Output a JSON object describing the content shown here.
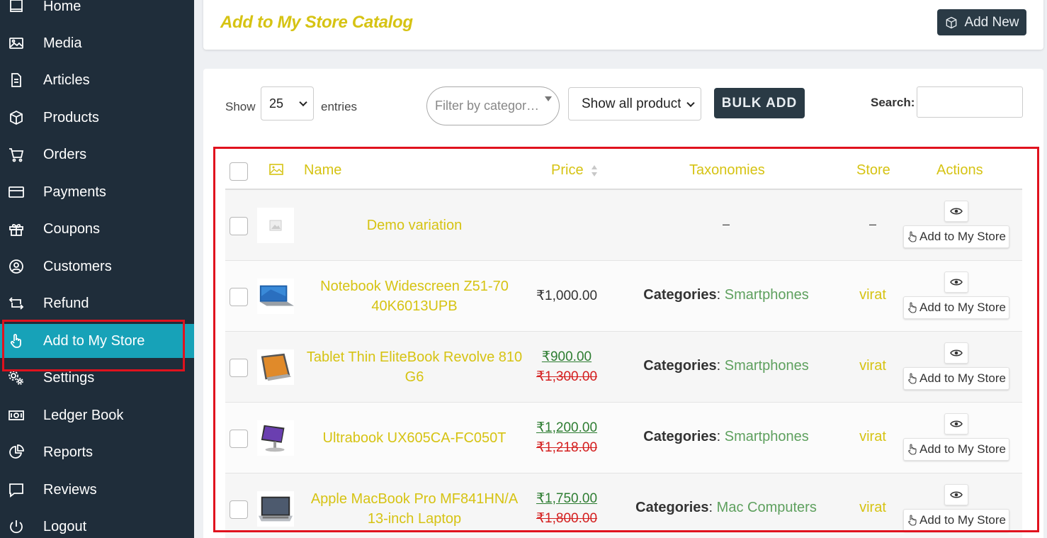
{
  "sidebar": {
    "items": [
      {
        "label": "Home",
        "icon": "home-icon"
      },
      {
        "label": "Media",
        "icon": "image-icon"
      },
      {
        "label": "Articles",
        "icon": "document-icon"
      },
      {
        "label": "Products",
        "icon": "box-icon"
      },
      {
        "label": "Orders",
        "icon": "cart-icon"
      },
      {
        "label": "Payments",
        "icon": "credit-card-icon"
      },
      {
        "label": "Coupons",
        "icon": "gift-icon"
      },
      {
        "label": "Customers",
        "icon": "user-circle-icon"
      },
      {
        "label": "Refund",
        "icon": "refund-icon"
      },
      {
        "label": "Add to My Store",
        "icon": "hand-pointer-icon",
        "active": true
      },
      {
        "label": "Settings",
        "icon": "cogs-icon"
      },
      {
        "label": "Ledger Book",
        "icon": "money-icon"
      },
      {
        "label": "Reports",
        "icon": "pie-chart-icon"
      },
      {
        "label": "Reviews",
        "icon": "comment-icon"
      },
      {
        "label": "Logout",
        "icon": "power-icon"
      }
    ]
  },
  "header": {
    "title": "Add to My Store Catalog",
    "add_new_label": "Add New"
  },
  "controls": {
    "show_label": "Show",
    "entries_value": "25",
    "entries_label": "entries",
    "category_placeholder": "Filter by categor…",
    "product_filter_value": "Show all products",
    "bulk_add_label": "BULK ADD",
    "search_label": "Search:",
    "search_value": ""
  },
  "table": {
    "columns": [
      "",
      "image-icon",
      "Name",
      "Price",
      "Taxonomies",
      "Store",
      "Actions"
    ],
    "add_to_store_label": "Add to My Store",
    "rows": [
      {
        "name": "Demo variation",
        "price": "",
        "sale_price": "",
        "old_price": "",
        "taxonomy_label": "",
        "taxonomy_value": "",
        "taxonomy_dash": "–",
        "store": "–",
        "thumb": "placeholder"
      },
      {
        "name": "Notebook Widescreen Z51-70 40K6013UPB",
        "price": "₹1,000.00",
        "sale_price": "",
        "old_price": "",
        "taxonomy_label": "Categories",
        "taxonomy_value": "Smartphones",
        "taxonomy_dash": "",
        "store": "virat",
        "thumb": "laptop"
      },
      {
        "name": "Tablet Thin EliteBook Revolve 810 G6",
        "price": "",
        "sale_price": "₹900.00",
        "old_price": "₹1,300.00",
        "taxonomy_label": "Categories",
        "taxonomy_value": "Smartphones",
        "taxonomy_dash": "",
        "store": "virat",
        "thumb": "tablet"
      },
      {
        "name": "Ultrabook UX605CA-FC050T",
        "price": "",
        "sale_price": "₹1,200.00",
        "old_price": "₹1,218.00",
        "taxonomy_label": "Categories",
        "taxonomy_value": "Smartphones",
        "taxonomy_dash": "",
        "store": "virat",
        "thumb": "stand"
      },
      {
        "name": "Apple MacBook Pro MF841HN/A 13-inch Laptop",
        "price": "",
        "sale_price": "₹1,750.00",
        "old_price": "₹1,800.00",
        "taxonomy_label": "Categories",
        "taxonomy_value": "Mac Computers",
        "taxonomy_dash": "",
        "store": "virat",
        "thumb": "macbook"
      }
    ]
  },
  "colors": {
    "sidebar_bg": "#1f2d3a",
    "active_bg": "#17a2b8",
    "accent_yellow": "#d6c313",
    "highlight_red": "#e0121e",
    "dark_button": "#2a3a45",
    "sale_green": "#2e7d32",
    "old_red": "#d41f1f",
    "category_green": "#5ea05e"
  }
}
